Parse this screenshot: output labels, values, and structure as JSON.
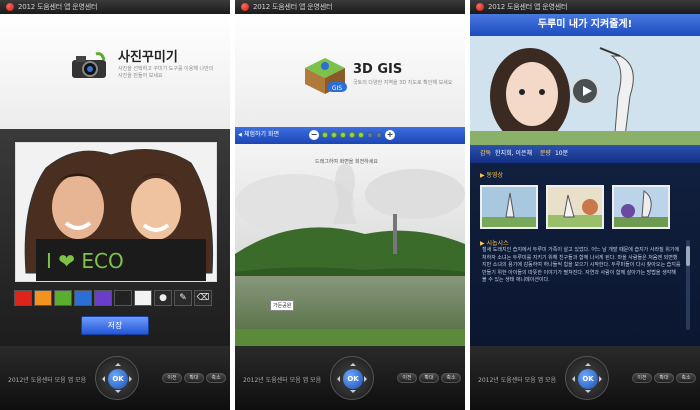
{
  "status_title": "2012 도움센터 앱 운영센터",
  "bottom_hint": "2012년 도움센터 모음 앱 모음",
  "ok_label": "OK",
  "softkeys": [
    "이전",
    "확대",
    "축소"
  ],
  "panel1": {
    "title": "사진꾸미기",
    "subtitle": "사진을 선택하고 꾸미기 도구를 이용해 나만의 사진을 만들어 보세요",
    "photo_text": "I ❤ ECO",
    "palette": [
      "#e0241b",
      "#f3921e",
      "#5aae2f",
      "#2b6fd6",
      "#6a3ec9",
      "#222222",
      "#f2f2f2"
    ],
    "tools": [
      "●",
      "✎",
      "⌫"
    ],
    "save_label": "저장"
  },
  "panel2": {
    "title": "3D GIS",
    "badge": "GIS",
    "subtitle": "국토의 다양한 지역을 3D 지도로 확인해 보세요",
    "back_label": "체험하기 화면",
    "zoom_minus": "−",
    "zoom_plus": "+",
    "zoom_level": 5,
    "zoom_max": 7,
    "hint": "드래그하여 화면을 회전하세요",
    "place_label": "가든공원"
  },
  "panel3": {
    "title": "두루미 내가 지켜줄게!",
    "meta_label1": "감독",
    "meta_value1": "한지희, 이은채",
    "meta_label2": "분량",
    "meta_value2": "10분",
    "section_gallery": "▶ 동영상",
    "section_story": "▶ 시놉시스",
    "story": "철새 도래지인 습지에서 두루미 가족이 살고 있었다. 어느 날 개발 때문에 습지가 사라질 위기에 처하자 소녀는 두루미를 지키기 위해 친구들과 함께 나서게 된다. 마을 사람들은 처음엔 외면했지만 소녀의 용기에 감동하여 하나둘씩 힘을 모으기 시작한다. 두루미들이 다시 찾아오는 습지를 만들기 위한 아이들의 따뜻한 이야기가 펼쳐진다. 자연과 사람이 함께 살아가는 방법을 생각해 볼 수 있는 생태 애니메이션이다."
  }
}
